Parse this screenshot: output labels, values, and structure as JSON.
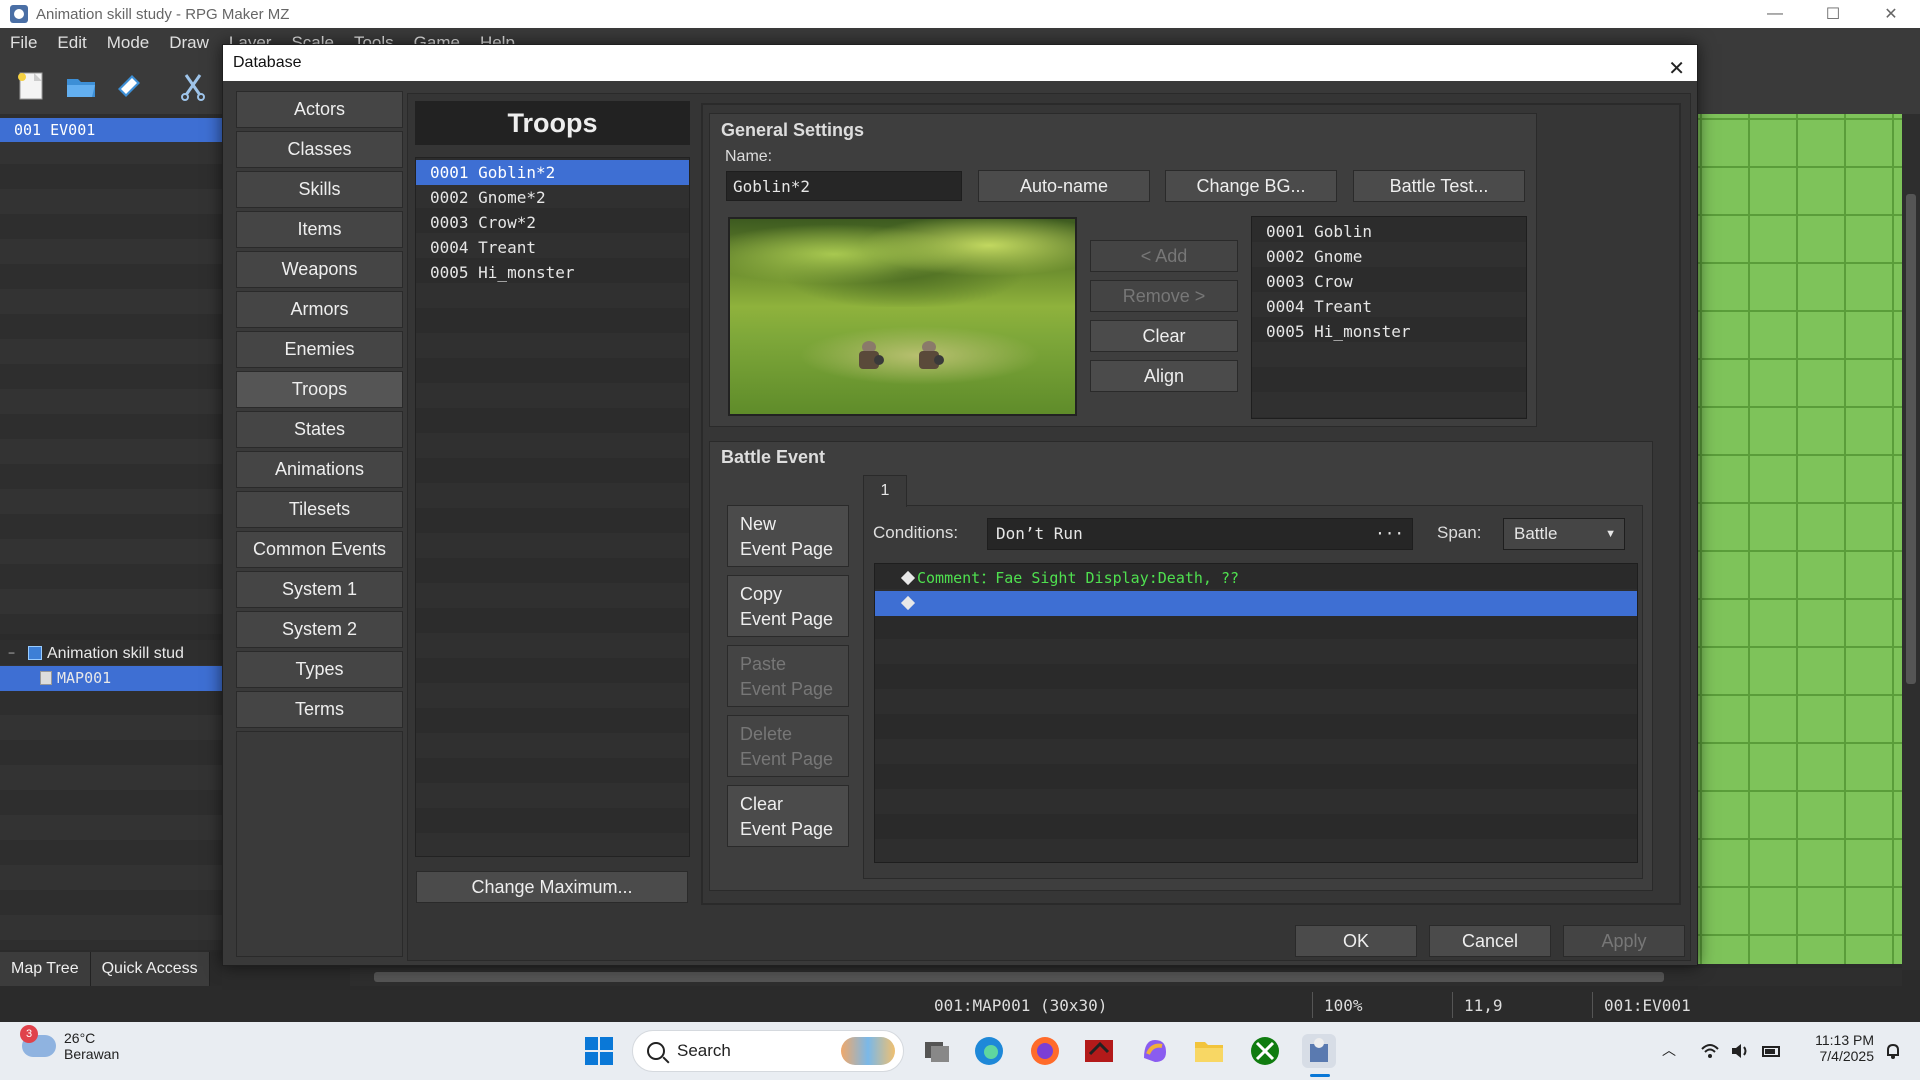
{
  "window": {
    "title": "Animation skill study - RPG Maker MZ",
    "controls": {
      "minimize": "—",
      "maximize": "☐",
      "close": "✕"
    }
  },
  "menu": [
    "File",
    "Edit",
    "Mode",
    "Draw",
    "Layer",
    "Scale",
    "Tools",
    "Game",
    "Help"
  ],
  "event_panel": {
    "selected": "001 EV001"
  },
  "map_tree": {
    "project": "Animation skill stud",
    "map": "MAP001"
  },
  "left_tabs": {
    "map_tree": "Map Tree",
    "quick_access": "Quick Access"
  },
  "status": {
    "map": "001:MAP001 (30x30)",
    "zoom": "100%",
    "coords": "11,9",
    "event": "001:EV001"
  },
  "taskbar": {
    "weather_badge": "3",
    "temperature": "26°C",
    "condition": "Berawan",
    "search_label": "Search",
    "time": "11:13 PM",
    "date": "7/4/2025"
  },
  "dialog": {
    "title": "Database",
    "close": "✕",
    "categories": [
      "Actors",
      "Classes",
      "Skills",
      "Items",
      "Weapons",
      "Armors",
      "Enemies",
      "Troops",
      "States",
      "Animations",
      "Tilesets",
      "Common Events",
      "System 1",
      "System 2",
      "Types",
      "Terms"
    ],
    "active_category": "Troops",
    "troops_header": "Troops",
    "troops": [
      "0001 Goblin*2",
      "0002 Gnome*2",
      "0003 Crow*2",
      "0004 Treant",
      "0005 Hi_monster"
    ],
    "change_maximum": "Change Maximum...",
    "general": {
      "label": "General Settings",
      "name_label": "Name:",
      "name_value": "Goblin*2",
      "auto_name": "Auto-name",
      "change_bg": "Change BG...",
      "battle_test": "Battle Test...",
      "add": "< Add",
      "remove": "Remove >",
      "clear": "Clear",
      "align": "Align",
      "enemies": [
        "0001 Goblin",
        "0002 Gnome",
        "0003 Crow",
        "0004 Treant",
        "0005 Hi_monster"
      ]
    },
    "battle_event": {
      "label": "Battle Event",
      "page_tab": "1",
      "new_page": [
        "New",
        "Event Page"
      ],
      "copy_page": [
        "Copy",
        "Event Page"
      ],
      "paste_page": [
        "Paste",
        "Event Page"
      ],
      "delete_page": [
        "Delete",
        "Event Page"
      ],
      "clear_page": [
        "Clear",
        "Event Page"
      ],
      "conditions_label": "Conditions:",
      "conditions_value": "Don’t Run",
      "conditions_more": "···",
      "span_label": "Span:",
      "span_value": "Battle",
      "commands": [
        "Comment：Fae Sight Display:Death, ??"
      ]
    },
    "ok": "OK",
    "cancel": "Cancel",
    "apply": "Apply"
  },
  "colors": {
    "selection": "#3e6fd3",
    "comment": "#4fe04f",
    "panel": "#393939"
  }
}
